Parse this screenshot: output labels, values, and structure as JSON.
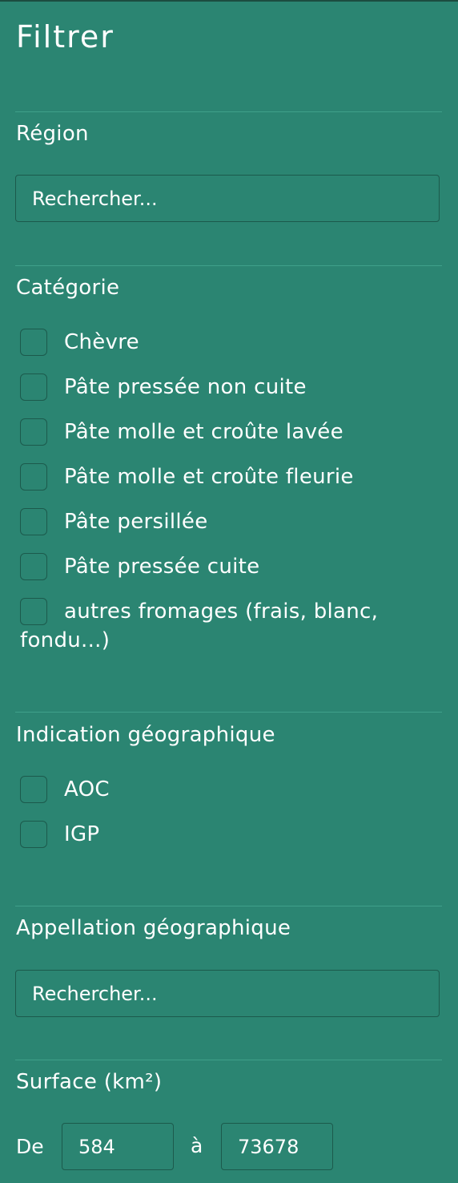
{
  "filter": {
    "title": "Filtrer",
    "region": {
      "label": "Région",
      "placeholder": "Rechercher..."
    },
    "categorie": {
      "label": "Catégorie",
      "options": [
        "Chèvre",
        "Pâte pressée non cuite",
        "Pâte molle et croûte lavée",
        "Pâte molle et croûte fleurie",
        "Pâte persillée",
        "Pâte pressée cuite",
        "autres fromages (frais, blanc, fondu...)"
      ]
    },
    "indication": {
      "label": "Indication géographique",
      "options": [
        "AOC",
        "IGP"
      ]
    },
    "appellation": {
      "label": "Appellation géographique",
      "placeholder": "Rechercher..."
    },
    "surface": {
      "label": "Surface (km²)",
      "from_label": "De",
      "from_value": "584",
      "to_label": "à",
      "to_value": "73678"
    }
  },
  "colors": {
    "background": "#2b8572",
    "border": "#1c5a4c",
    "divider": "#3fa08a",
    "text": "#ffffff"
  }
}
